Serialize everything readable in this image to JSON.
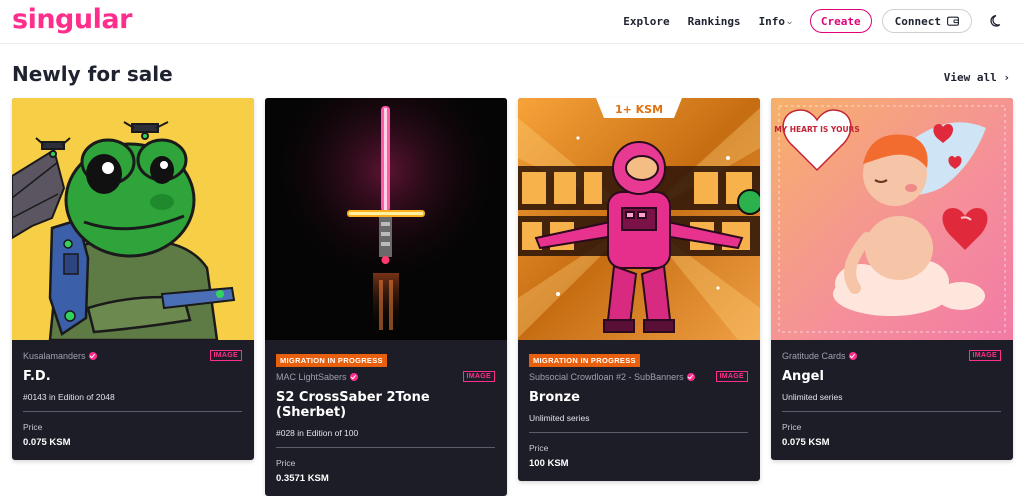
{
  "header": {
    "logo": "singular",
    "nav": {
      "explore": "Explore",
      "rankings": "Rankings",
      "info": "Info"
    },
    "create_label": "Create",
    "connect_label": "Connect"
  },
  "section": {
    "title": "Newly for sale",
    "view_all": "View all ›"
  },
  "cards": [
    {
      "collection": "Kusalamanders",
      "type": "IMAGE",
      "name": "F.D.",
      "edition": "#0143 in Edition of 2048",
      "price_label": "Price",
      "price": "0.075 KSM"
    },
    {
      "badge": "MIGRATION IN PROGRESS",
      "collection": "MAC LightSabers",
      "type": "IMAGE",
      "name": "S2 CrossSaber 2Tone (Sherbet)",
      "edition": "#028 in Edition of 100",
      "price_label": "Price",
      "price": "0.3571 KSM"
    },
    {
      "badge": "MIGRATION IN PROGRESS",
      "collection": "Subsocial Crowdloan #2 - SubBanners",
      "type": "IMAGE",
      "name": "Bronze",
      "edition": "Unlimited series",
      "price_label": "Price",
      "price": "100 KSM",
      "art_text": "1+ KSM"
    },
    {
      "collection": "Gratitude Cards",
      "type": "IMAGE",
      "name": "Angel",
      "edition": "Unlimited series",
      "price_label": "Price",
      "price": "0.075 KSM",
      "art_text": "MY HEART IS YOURS"
    }
  ],
  "colors": {
    "brand": "#ff2e8c",
    "card_bg": "#1c1d26",
    "migration_badge": "#e8600d"
  },
  "icons": {
    "wallet": "wallet-icon",
    "theme": "moon-icon",
    "verified": "verified-check-icon"
  }
}
